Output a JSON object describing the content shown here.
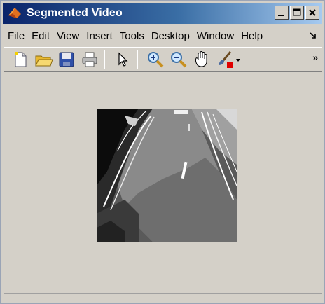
{
  "window": {
    "title": "Segmented Video"
  },
  "menubar": {
    "items": [
      "File",
      "Edit",
      "View",
      "Insert",
      "Tools",
      "Desktop",
      "Window",
      "Help"
    ]
  },
  "toolbar": {
    "icons": [
      "new-file-icon",
      "open-folder-icon",
      "save-icon",
      "print-icon",
      "pointer-arrow-icon",
      "zoom-in-icon",
      "zoom-out-icon",
      "pan-hand-icon",
      "brush-icon"
    ],
    "overflow_glyph": "»"
  },
  "title_buttons": [
    "minimize",
    "maximize",
    "close"
  ],
  "figure": {
    "content": "segmented-road-image"
  },
  "colors": {
    "title_start": "#0a246a",
    "title_end": "#a6caf0",
    "chrome": "#d4d0c8"
  }
}
